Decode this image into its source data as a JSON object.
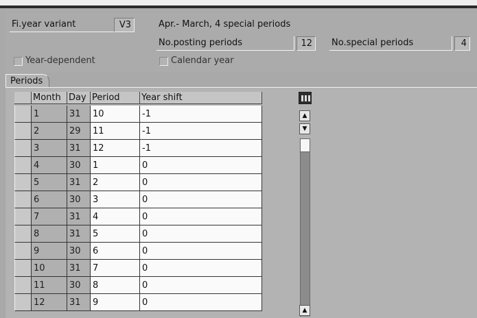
{
  "header": {
    "fy_variant_label": "Fi.year variant",
    "fy_variant_value": "V3",
    "fy_variant_desc": "Apr.- March, 4 special periods",
    "posting_periods_label": "No.posting periods",
    "posting_periods_value": "12",
    "special_periods_label": "No.special periods",
    "special_periods_value": "4",
    "year_dependent_label": "Year-dependent",
    "year_dependent_checked": false,
    "calendar_year_label": "Calendar year",
    "calendar_year_checked": false
  },
  "tab": {
    "label": "Periods"
  },
  "table": {
    "columns": [
      "Month",
      "Day",
      "Period",
      "Year shift"
    ],
    "rows": [
      {
        "month": "1",
        "day": "31",
        "period": "10",
        "shift": "-1"
      },
      {
        "month": "2",
        "day": "29",
        "period": "11",
        "shift": "-1"
      },
      {
        "month": "3",
        "day": "31",
        "period": "12",
        "shift": "-1"
      },
      {
        "month": "4",
        "day": "30",
        "period": "1",
        "shift": "0"
      },
      {
        "month": "5",
        "day": "31",
        "period": "2",
        "shift": "0"
      },
      {
        "month": "6",
        "day": "30",
        "period": "3",
        "shift": "0"
      },
      {
        "month": "7",
        "day": "31",
        "period": "4",
        "shift": "0"
      },
      {
        "month": "8",
        "day": "31",
        "period": "5",
        "shift": "0"
      },
      {
        "month": "9",
        "day": "30",
        "period": "6",
        "shift": "0"
      },
      {
        "month": "10",
        "day": "31",
        "period": "7",
        "shift": "0"
      },
      {
        "month": "11",
        "day": "30",
        "period": "8",
        "shift": "0"
      },
      {
        "month": "12",
        "day": "31",
        "period": "9",
        "shift": "0"
      }
    ]
  },
  "colors": {
    "background": "#a9a9a9",
    "editable_cell": "#fafafa",
    "key_cell": "#b0b0b0"
  }
}
